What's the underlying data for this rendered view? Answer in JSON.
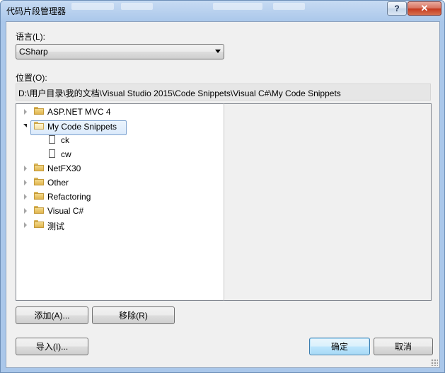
{
  "window": {
    "title": "代码片段管理器",
    "help_label": "?",
    "close_label": "✕"
  },
  "language": {
    "label": "语言(L):",
    "selected": "CSharp"
  },
  "location": {
    "label": "位置(O):",
    "path": "D:\\用户目录\\我的文档\\Visual Studio 2015\\Code Snippets\\Visual C#\\My Code Snippets"
  },
  "tree": {
    "items": [
      {
        "label": "ASP.NET MVC 4",
        "icon": "folder-icon",
        "expanded": false
      },
      {
        "label": "My Code Snippets",
        "icon": "folder-open-icon",
        "expanded": true,
        "selected": true
      },
      {
        "label": "ck",
        "icon": "snippet-file-icon"
      },
      {
        "label": "cw",
        "icon": "snippet-file-icon"
      },
      {
        "label": "NetFX30",
        "icon": "folder-icon",
        "expanded": false
      },
      {
        "label": "Other",
        "icon": "folder-icon",
        "expanded": false
      },
      {
        "label": "Refactoring",
        "icon": "folder-icon",
        "expanded": false
      },
      {
        "label": "Visual C#",
        "icon": "folder-icon",
        "expanded": false
      },
      {
        "label": "测试",
        "icon": "folder-icon",
        "expanded": false
      }
    ]
  },
  "buttons": {
    "add": "添加(A)...",
    "remove": "移除(R)",
    "import": "导入(I)...",
    "ok": "确定",
    "cancel": "取消"
  },
  "colors": {
    "accent": "#3c7fb1",
    "selection": "#dbeafb",
    "title_bar": "#aac7ea"
  }
}
